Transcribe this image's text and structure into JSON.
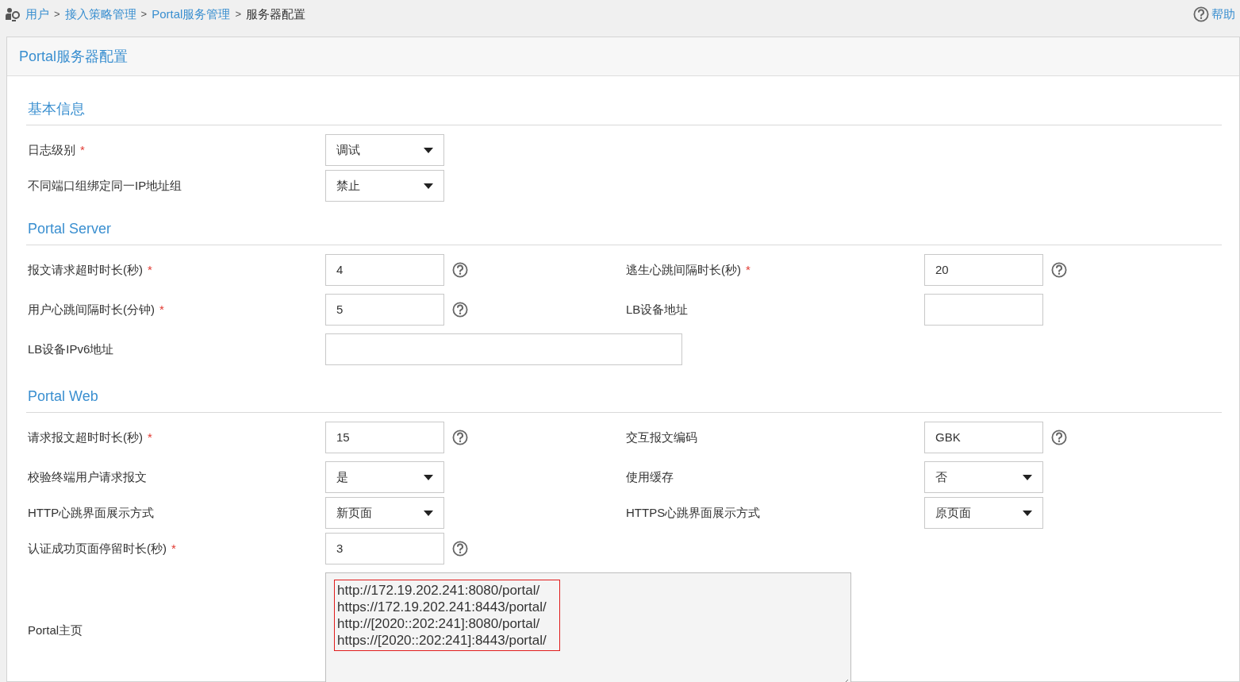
{
  "breadcrumb": {
    "items": [
      {
        "label": "用户",
        "link": true
      },
      {
        "label": "接入策略管理",
        "link": true
      },
      {
        "label": "Portal服务管理",
        "link": true
      },
      {
        "label": "服务器配置",
        "link": false
      }
    ],
    "separators": [
      ">",
      ">",
      ">"
    ]
  },
  "help_link": "帮助",
  "panel": {
    "title": "Portal服务器配置"
  },
  "sections": [
    {
      "title": "基本信息",
      "rows": [
        {
          "fields": [
            {
              "label": "日志级别",
              "required_mark": "*",
              "kind": "select",
              "value": "调试"
            }
          ]
        },
        {
          "fields": [
            {
              "label": "不同端口组绑定同一IP地址组",
              "kind": "select",
              "value": "禁止"
            }
          ]
        }
      ]
    },
    {
      "title": "Portal Server",
      "rows": [
        {
          "fields": [
            {
              "label": "报文请求超时时长(秒)",
              "required_mark": "*",
              "kind": "input",
              "value": "4",
              "help": true
            },
            {
              "label": "逃生心跳间隔时长(秒)",
              "required_mark": "*",
              "kind": "input",
              "value": "20",
              "help": true
            }
          ]
        },
        {
          "fields": [
            {
              "label": "用户心跳间隔时长(分钟)",
              "required_mark": "*",
              "kind": "input",
              "value": "5",
              "help": true
            },
            {
              "label": "LB设备地址",
              "kind": "input"
            }
          ]
        },
        {
          "fields": [
            {
              "label": "LB设备IPv6地址",
              "kind": "wide-input"
            }
          ]
        }
      ]
    },
    {
      "title": "Portal Web",
      "rows": [
        {
          "fields": [
            {
              "label": "请求报文超时时长(秒)",
              "required_mark": "*",
              "kind": "input",
              "value": "15",
              "help": true
            },
            {
              "label": "交互报文编码",
              "kind": "input",
              "value": "GBK",
              "help": true
            }
          ]
        },
        {
          "fields": [
            {
              "label": "校验终端用户请求报文",
              "kind": "select",
              "value": "是"
            },
            {
              "label": "使用缓存",
              "kind": "select",
              "value": "否"
            }
          ]
        },
        {
          "fields": [
            {
              "label": "HTTP心跳界面展示方式",
              "kind": "select",
              "value": "新页面"
            },
            {
              "label": "HTTPS心跳界面展示方式",
              "kind": "select",
              "value": "原页面"
            }
          ]
        },
        {
          "fields": [
            {
              "label": "认证成功页面停留时长(秒)",
              "required_mark": "*",
              "kind": "input",
              "value": "3",
              "help": true
            }
          ]
        },
        {
          "fields": [
            {
              "label": "Portal主页",
              "kind": "textarea",
              "highlighted": true,
              "lines": [
                "http://172.19.202.241:8080/portal/",
                "https://172.19.202.241:8443/portal/",
                "http://[2020::202:241]:8080/portal/",
                "https://[2020::202:241]:8443/portal/"
              ]
            }
          ]
        }
      ]
    }
  ]
}
